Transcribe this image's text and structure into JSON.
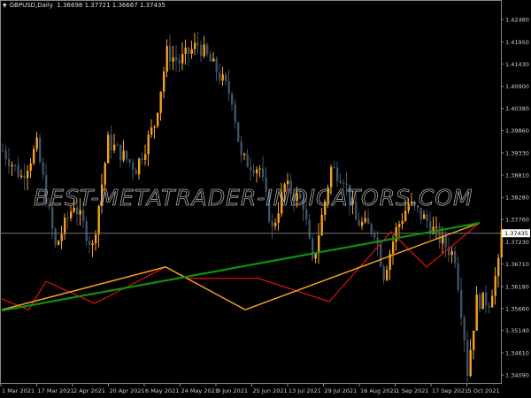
{
  "header": {
    "symbol": "GBPUSD,Daily",
    "open": "1.36698",
    "high": "1.37721",
    "low": "1.36667",
    "close": "1.37435"
  },
  "watermark": "BEST-METATRADER-INDICATORS.COM",
  "colors": {
    "bull": "#f5a11c",
    "bear": "#3e5266",
    "red": "#e01010",
    "orange": "#f0a020",
    "green": "#109010",
    "grid": "#888",
    "bidline": "#777"
  },
  "chart_data": {
    "type": "candlestick",
    "title": "GBPUSD,Daily",
    "ylim": [
      1.339,
      1.429
    ],
    "bars": 162,
    "price_ticks": [
      "1.42480",
      "1.41950",
      "1.41430",
      "1.40900",
      "1.40380",
      "1.39860",
      "1.39330",
      "1.38810",
      "1.38280",
      "1.37760",
      "1.37230",
      "1.36710",
      "1.36180",
      "1.35660",
      "1.35140",
      "1.34610",
      "1.34090"
    ],
    "date_ticks": [
      "1 Mar 2021",
      "17 Mar 2021",
      "2 Apr 2021",
      "20 Apr 2021",
      "6 May 2021",
      "24 May 2021",
      "9 Jun 2021",
      "25 Jun 2021",
      "13 Jul 2021",
      "29 Jul 2021",
      "16 Aug 2021",
      "1 Sep 2021",
      "17 Sep 2021",
      "5 Oct 2021"
    ],
    "current_price": "1.37435",
    "close_path": [
      [
        0,
        1.3939
      ],
      [
        6,
        1.3877
      ],
      [
        11,
        1.395
      ],
      [
        17,
        1.371
      ],
      [
        23,
        1.3814
      ],
      [
        29,
        1.371
      ],
      [
        34,
        1.396
      ],
      [
        43,
        1.3897
      ],
      [
        49,
        1.4002
      ],
      [
        53,
        1.4169
      ],
      [
        57,
        1.4148
      ],
      [
        63,
        1.419
      ],
      [
        69,
        1.4127
      ],
      [
        74,
        1.4064
      ],
      [
        77,
        1.3918
      ],
      [
        83,
        1.3897
      ],
      [
        87,
        1.3751
      ],
      [
        91,
        1.3856
      ],
      [
        97,
        1.3814
      ],
      [
        100,
        1.3668
      ],
      [
        106,
        1.3897
      ],
      [
        110,
        1.3877
      ],
      [
        114,
        1.3772
      ],
      [
        120,
        1.3751
      ],
      [
        123,
        1.3647
      ],
      [
        127,
        1.3751
      ],
      [
        131,
        1.3814
      ],
      [
        137,
        1.3772
      ],
      [
        141,
        1.373
      ],
      [
        146,
        1.3689
      ],
      [
        149,
        1.3501
      ],
      [
        150,
        1.3417
      ],
      [
        153,
        1.3584
      ],
      [
        157,
        1.3584
      ],
      [
        160,
        1.3668
      ],
      [
        161,
        1.3744
      ]
    ],
    "series": [
      {
        "name": "red-zigzag",
        "points": [
          [
            0,
            1.3589
          ],
          [
            8.6,
            1.3563
          ],
          [
            14.3,
            1.363
          ],
          [
            30,
            1.3578
          ],
          [
            52.9,
            1.3664
          ],
          [
            60,
            1.3637
          ],
          [
            82.9,
            1.3637
          ],
          [
            105.7,
            1.3582
          ],
          [
            125.7,
            1.3747
          ],
          [
            137.1,
            1.3664
          ],
          [
            154.3,
            1.3768
          ]
        ]
      },
      {
        "name": "orange-zigzag",
        "points": [
          [
            0,
            1.3563
          ],
          [
            52.9,
            1.3664
          ],
          [
            78.6,
            1.3563
          ],
          [
            154.3,
            1.3768
          ]
        ]
      },
      {
        "name": "green-trendline",
        "points": [
          [
            0,
            1.3561
          ],
          [
            154.3,
            1.3768
          ]
        ]
      }
    ]
  }
}
